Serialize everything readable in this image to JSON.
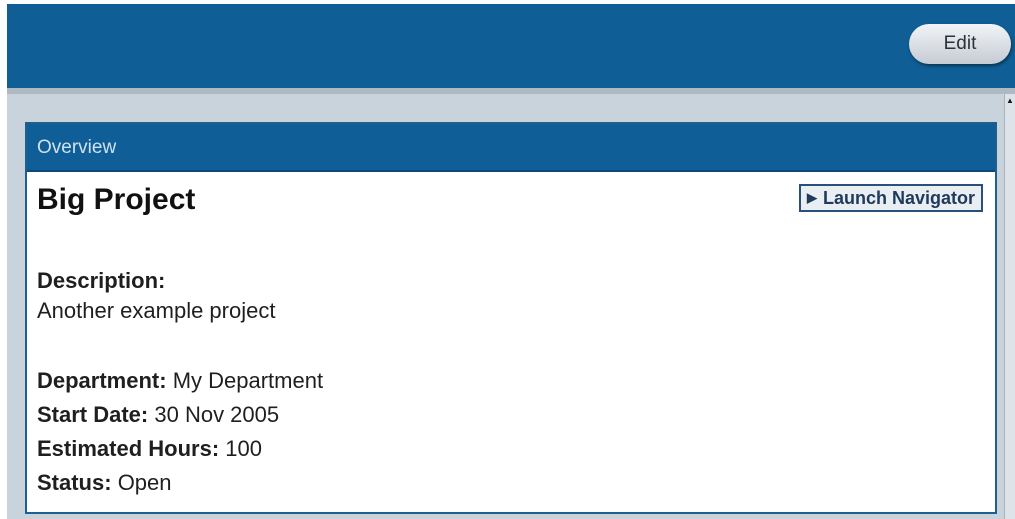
{
  "toolbar": {
    "edit_label": "Edit"
  },
  "panel": {
    "header": "Overview",
    "project_title": "Big Project",
    "launch_navigator_label": "Launch Navigator",
    "description_label": "Description:",
    "description_value": "Another example project",
    "fields": [
      {
        "label": "Department:",
        "value": "My Department"
      },
      {
        "label": "Start Date:",
        "value": "30 Nov 2005"
      },
      {
        "label": "Estimated Hours:",
        "value": "100"
      },
      {
        "label": "Status:",
        "value": "Open"
      }
    ]
  },
  "colors": {
    "header_blue": "#0f5f96",
    "panel_border": "#1e5f90",
    "background_gray": "#c9d3db"
  },
  "icons": {
    "launch": "play-triangle-icon",
    "scroll_up": "scroll-up-arrow-icon"
  }
}
